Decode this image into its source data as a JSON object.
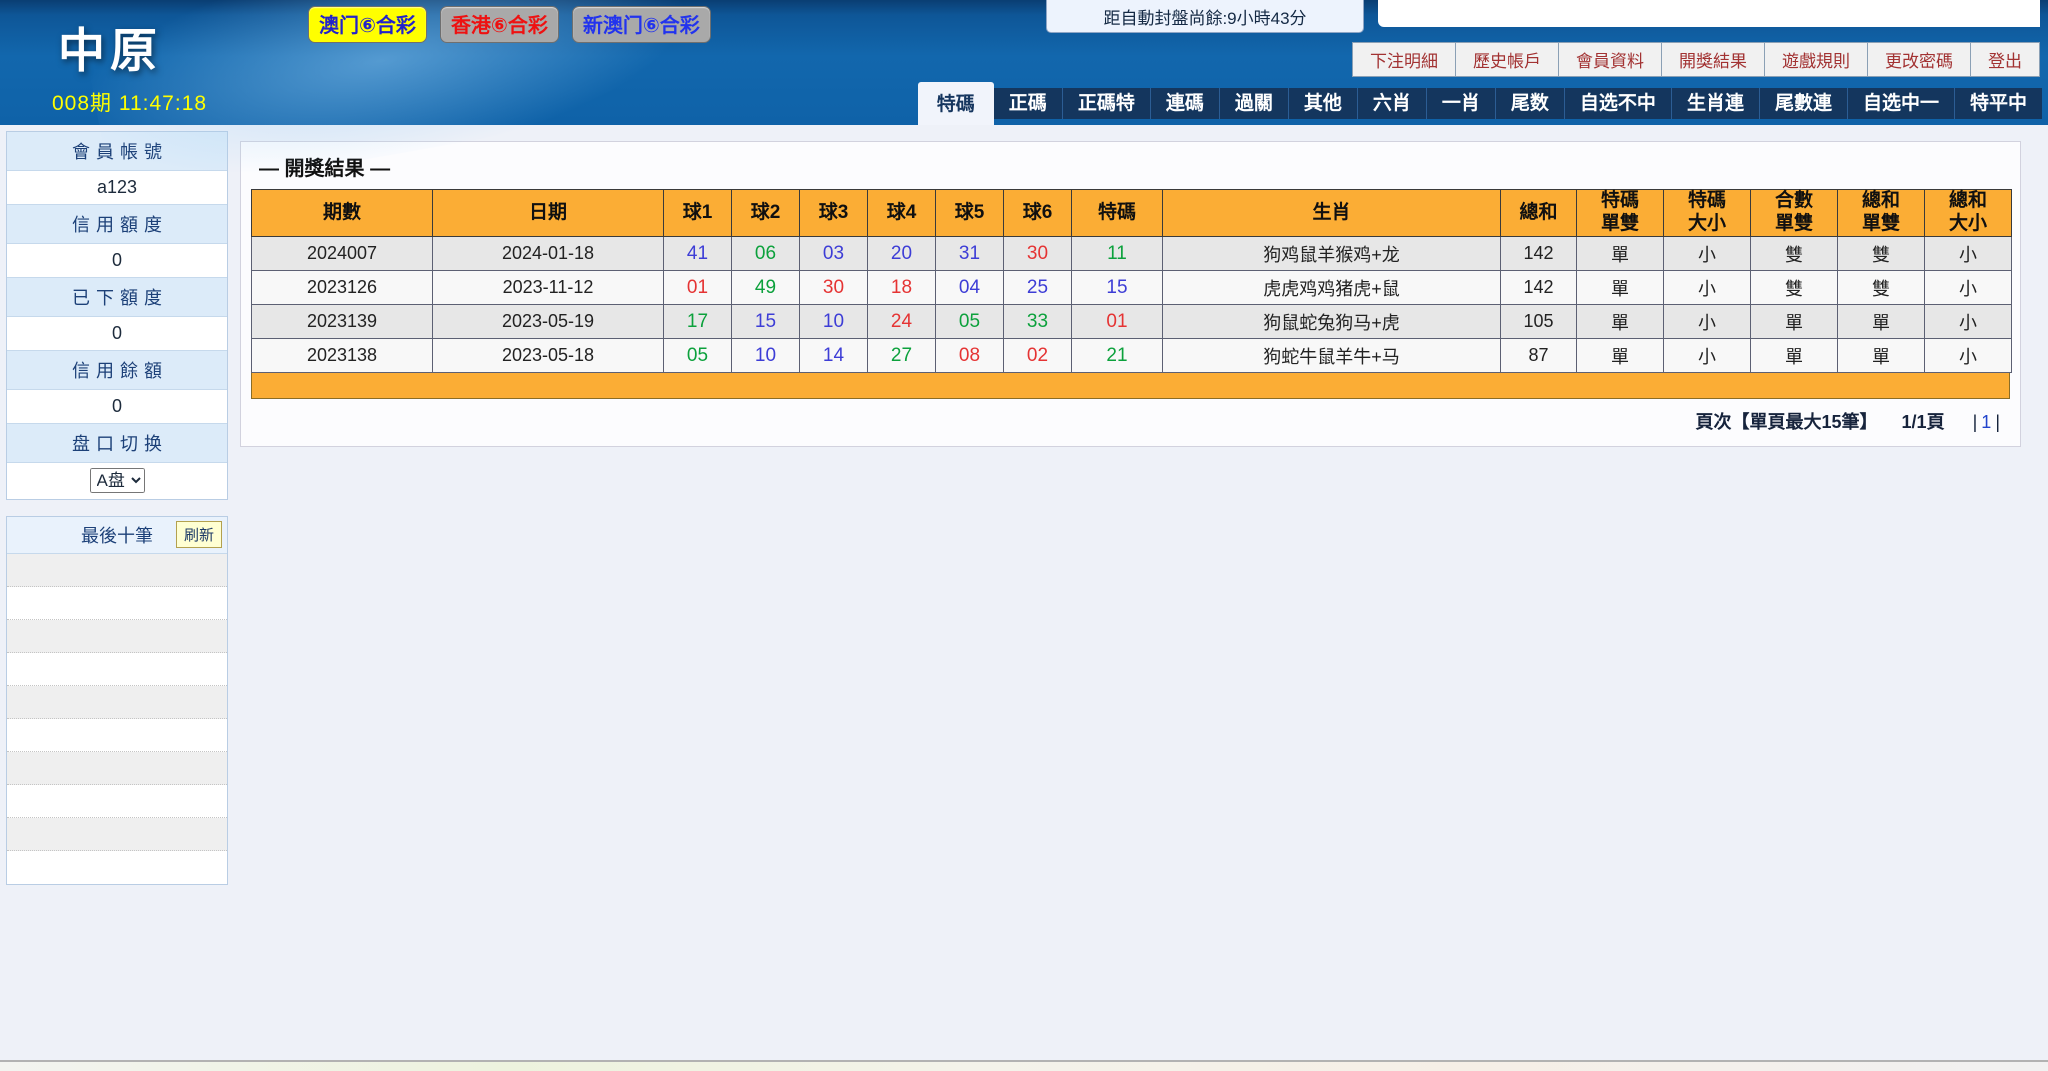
{
  "header": {
    "logo": "中原",
    "lottery_tabs": [
      {
        "label": "澳门⑥合彩",
        "active": true,
        "bg": "#ffff00",
        "color": "#2222cc"
      },
      {
        "label": "香港⑥合彩",
        "active": false,
        "bg": "#a9a9a9",
        "color": "#ee1111"
      },
      {
        "label": "新澳门⑥合彩",
        "active": false,
        "bg": "#a9a9a9",
        "color": "#2233ee"
      }
    ],
    "countdown": "距自動封盤尚餘:9小時43分",
    "period_clock": "008期 11:47:18",
    "user_menu": [
      "下注明細",
      "歷史帳戶",
      "會員資料",
      "開獎結果",
      "遊戲規則",
      "更改密碼",
      "登出"
    ],
    "nav_tabs": [
      {
        "label": "特碼",
        "active": true
      },
      {
        "label": "正碼",
        "active": false
      },
      {
        "label": "正碼特",
        "active": false
      },
      {
        "label": "連碼",
        "active": false
      },
      {
        "label": "過關",
        "active": false
      },
      {
        "label": "其他",
        "active": false
      },
      {
        "label": "六肖",
        "active": false
      },
      {
        "label": "一肖",
        "active": false
      },
      {
        "label": "尾数",
        "active": false
      },
      {
        "label": "自选不中",
        "active": false
      },
      {
        "label": "生肖連",
        "active": false
      },
      {
        "label": "尾數連",
        "active": false
      },
      {
        "label": "自选中一",
        "active": false
      },
      {
        "label": "特平中",
        "active": false
      }
    ]
  },
  "sidebar": {
    "fields": [
      {
        "label": "會員帳號",
        "value": "a123"
      },
      {
        "label": "信用額度",
        "value": "0"
      },
      {
        "label": "已下額度",
        "value": "0"
      },
      {
        "label": "信用餘額",
        "value": "0"
      }
    ],
    "plate_label": "盘口切换",
    "plate_selected": "A盘",
    "last_ten_label": "最後十筆",
    "refresh_label": "刷新",
    "empty_rows": 10
  },
  "results": {
    "title": "— 開獎結果 —",
    "columns": [
      "期數",
      "日期",
      "球1",
      "球2",
      "球3",
      "球4",
      "球5",
      "球6",
      "特碼",
      "生肖",
      "總和",
      "特碼\n單雙",
      "特碼\n大小",
      "合數\n單雙",
      "總和\n單雙",
      "總和\n大小"
    ],
    "rows": [
      {
        "period": "2024007",
        "date": "2024-01-18",
        "balls": [
          [
            "41",
            "b"
          ],
          [
            "06",
            "g"
          ],
          [
            "03",
            "b"
          ],
          [
            "20",
            "b"
          ],
          [
            "31",
            "b"
          ],
          [
            "30",
            "r"
          ]
        ],
        "special": [
          "11",
          "g"
        ],
        "zodiac": "狗鸡鼠羊猴鸡+龙",
        "total": "142",
        "flags": [
          "單",
          "小",
          "雙",
          "雙",
          "小"
        ]
      },
      {
        "period": "2023126",
        "date": "2023-11-12",
        "balls": [
          [
            "01",
            "r"
          ],
          [
            "49",
            "g"
          ],
          [
            "30",
            "r"
          ],
          [
            "18",
            "r"
          ],
          [
            "04",
            "b"
          ],
          [
            "25",
            "b"
          ]
        ],
        "special": [
          "15",
          "b"
        ],
        "zodiac": "虎虎鸡鸡猪虎+鼠",
        "total": "142",
        "flags": [
          "單",
          "小",
          "雙",
          "雙",
          "小"
        ]
      },
      {
        "period": "2023139",
        "date": "2023-05-19",
        "balls": [
          [
            "17",
            "g"
          ],
          [
            "15",
            "b"
          ],
          [
            "10",
            "b"
          ],
          [
            "24",
            "r"
          ],
          [
            "05",
            "g"
          ],
          [
            "33",
            "g"
          ]
        ],
        "special": [
          "01",
          "r"
        ],
        "zodiac": "狗鼠蛇兔狗马+虎",
        "total": "105",
        "flags": [
          "單",
          "小",
          "單",
          "單",
          "小"
        ]
      },
      {
        "period": "2023138",
        "date": "2023-05-18",
        "balls": [
          [
            "05",
            "g"
          ],
          [
            "10",
            "b"
          ],
          [
            "14",
            "b"
          ],
          [
            "27",
            "g"
          ],
          [
            "08",
            "r"
          ],
          [
            "02",
            "r"
          ]
        ],
        "special": [
          "21",
          "g"
        ],
        "zodiac": "狗蛇牛鼠羊牛+马",
        "total": "87",
        "flags": [
          "單",
          "小",
          "單",
          "單",
          "小"
        ]
      }
    ],
    "pagination": {
      "label": "頁次【單頁最大15筆】",
      "page": "1/1頁",
      "link": "1"
    }
  },
  "colors": {
    "ball": {
      "r": "#e53333",
      "g": "#0ca13c",
      "b": "#3d3dd6"
    },
    "accent_orange": "#fbad35",
    "header_blue": "#1166ae",
    "tab_navy": "#14365e"
  }
}
